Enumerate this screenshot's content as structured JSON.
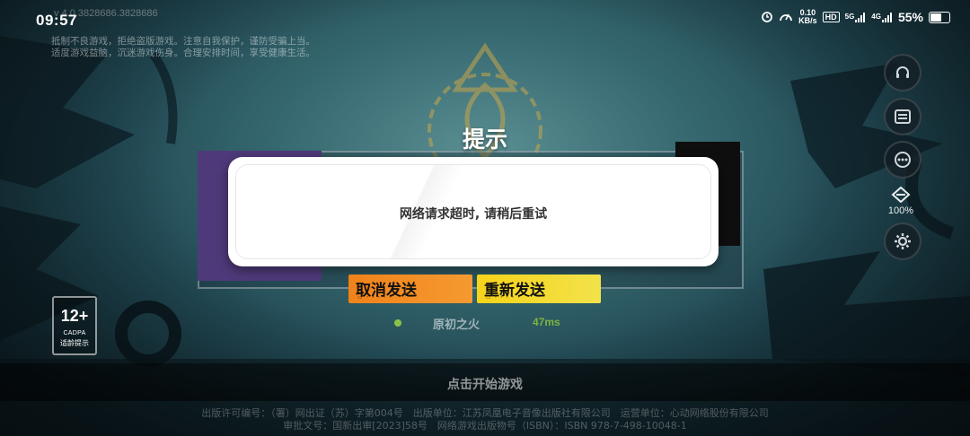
{
  "status_bar": {
    "time": "09:57",
    "net_speed_value": "0.10",
    "net_speed_unit": "KB/s",
    "hd_label": "HD",
    "signal1_label": "5G",
    "signal2_label": "4G",
    "battery_percent": "55%"
  },
  "version_text": "v 4.0.3828686.3828686",
  "health_notice": {
    "line1": "抵制不良游戏，拒绝盗版游戏。注意自我保护，谨防受骗上当。",
    "line2": "适度游戏益脑，沉迷游戏伤身。合理安排时间，享受健康生活。"
  },
  "side_panel": {
    "network_percent": "100%"
  },
  "age_rating": {
    "number": "12+",
    "org": "CADPA",
    "tip": "适龄提示"
  },
  "dialog": {
    "title": "提示",
    "message": "网络请求超时, 请稍后重试",
    "cancel_label": "取消发送",
    "retry_label": "重新发送"
  },
  "server": {
    "name": "原初之火",
    "ping": "47ms"
  },
  "start_game_label": "点击开始游戏",
  "license": {
    "line1": "出版许可编号：（署）网出证（苏）字第004号　出版单位：江苏凤凰电子音像出版社有限公司　运营单位：心动网络股份有限公司",
    "line2": "审批文号：国新出审[2023]58号　网络游戏出版物号（ISBN）：ISBN 978-7-498-10048-1"
  },
  "colors": {
    "cancel_button": "#f0821a",
    "retry_button": "#f7d31a",
    "server_ping": "#7cb342"
  }
}
